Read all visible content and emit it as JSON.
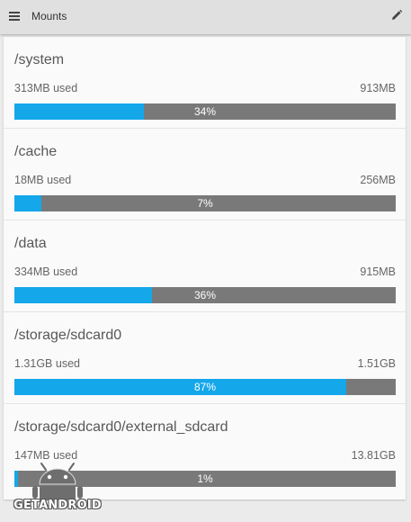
{
  "toolbar": {
    "title": "Mounts",
    "menu_icon": "menu-icon",
    "edit_icon": "pencil-icon"
  },
  "colors": {
    "fill": "#14a7ea",
    "track": "#797979",
    "background": "#ebebeb"
  },
  "mounts": [
    {
      "name": "/system",
      "used": "313MB used",
      "total": "913MB",
      "percent_label": "34%",
      "fraction": 0.34
    },
    {
      "name": "/cache",
      "used": "18MB used",
      "total": "256MB",
      "percent_label": "7%",
      "fraction": 0.07
    },
    {
      "name": "/data",
      "used": "334MB used",
      "total": "915MB",
      "percent_label": "36%",
      "fraction": 0.36
    },
    {
      "name": "/storage/sdcard0",
      "used": "1.31GB used",
      "total": "1.51GB",
      "percent_label": "87%",
      "fraction": 0.87
    },
    {
      "name": "/storage/sdcard0/external_sdcard",
      "used": "147MB used",
      "total": "13.81GB",
      "percent_label": "1%",
      "fraction": 0.01
    }
  ],
  "watermark": {
    "text": "GETANDROID"
  }
}
